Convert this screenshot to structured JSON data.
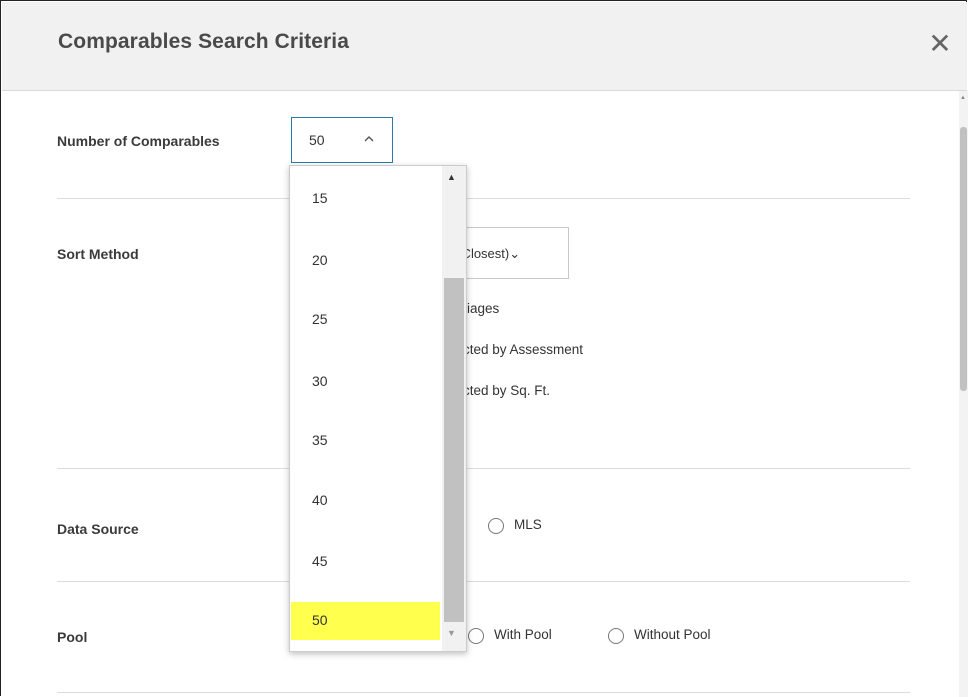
{
  "dialog": {
    "title": "Comparables Search Criteria",
    "close_glyph": "✕"
  },
  "number_of_comparables": {
    "label": "Number of Comparables",
    "value": "50",
    "chevron": "^",
    "options": [
      "15",
      "20",
      "25",
      "30",
      "35",
      "40",
      "45",
      "50"
    ],
    "selected": "50"
  },
  "sort_method": {
    "label": "Sort Method",
    "select_value": "t (Closest)",
    "select_chevron": "⌄",
    "options_text": [
      "iages",
      "cted by Assessment",
      "cted by Sq. Ft."
    ]
  },
  "data_source": {
    "label": "Data Source",
    "radio_mls": "MLS"
  },
  "pool": {
    "label": "Pool",
    "with_pool": "With Pool",
    "without_pool": "Without Pool"
  },
  "icons": {
    "close": "close-icon",
    "chevron_up": "chevron-up-icon",
    "scroll_up": "scroll-up-arrow-icon",
    "scroll_down": "scroll-down-arrow-icon"
  },
  "colors": {
    "highlight": "#ffff4d",
    "select_border": "#2a7ab0",
    "header_bg": "#f1f1f1"
  }
}
